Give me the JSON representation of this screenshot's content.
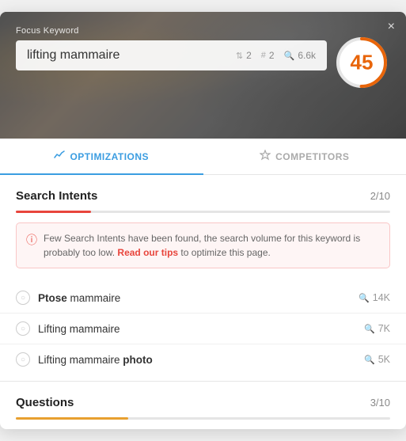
{
  "header": {
    "focus_keyword_label": "Focus Keyword",
    "keyword": "lifting mammaire",
    "meta": [
      {
        "icon": "▲",
        "value": "2"
      },
      {
        "icon": "#",
        "value": "2"
      },
      {
        "icon": "🔍",
        "value": "6.6k"
      }
    ],
    "score": 45,
    "close_label": "×"
  },
  "tabs": [
    {
      "id": "optimizations",
      "label": "OPTIMIZATIONS",
      "icon": "📈",
      "active": true
    },
    {
      "id": "competitors",
      "label": "COMPETITORS",
      "icon": "🏆",
      "active": false
    }
  ],
  "search_intents": {
    "title": "Search Intents",
    "score": "2/10",
    "progress_pct": 20,
    "alert": {
      "text": "Few Search Intents have been found, the search volume for this keyword is probably too low. ",
      "link_text": "Read our tips",
      "link_suffix": " to optimize this page."
    },
    "items": [
      {
        "name_plain": "Ptose",
        "name_bold": " mammaire",
        "volume": "14K"
      },
      {
        "name_plain": "Lifting mammaire",
        "name_bold": "",
        "volume": "7K"
      },
      {
        "name_plain": "Lifting mammaire ",
        "name_bold": "photo",
        "volume": "5K"
      }
    ]
  },
  "questions": {
    "title": "Questions",
    "score": "3/10",
    "progress_pct": 30
  }
}
